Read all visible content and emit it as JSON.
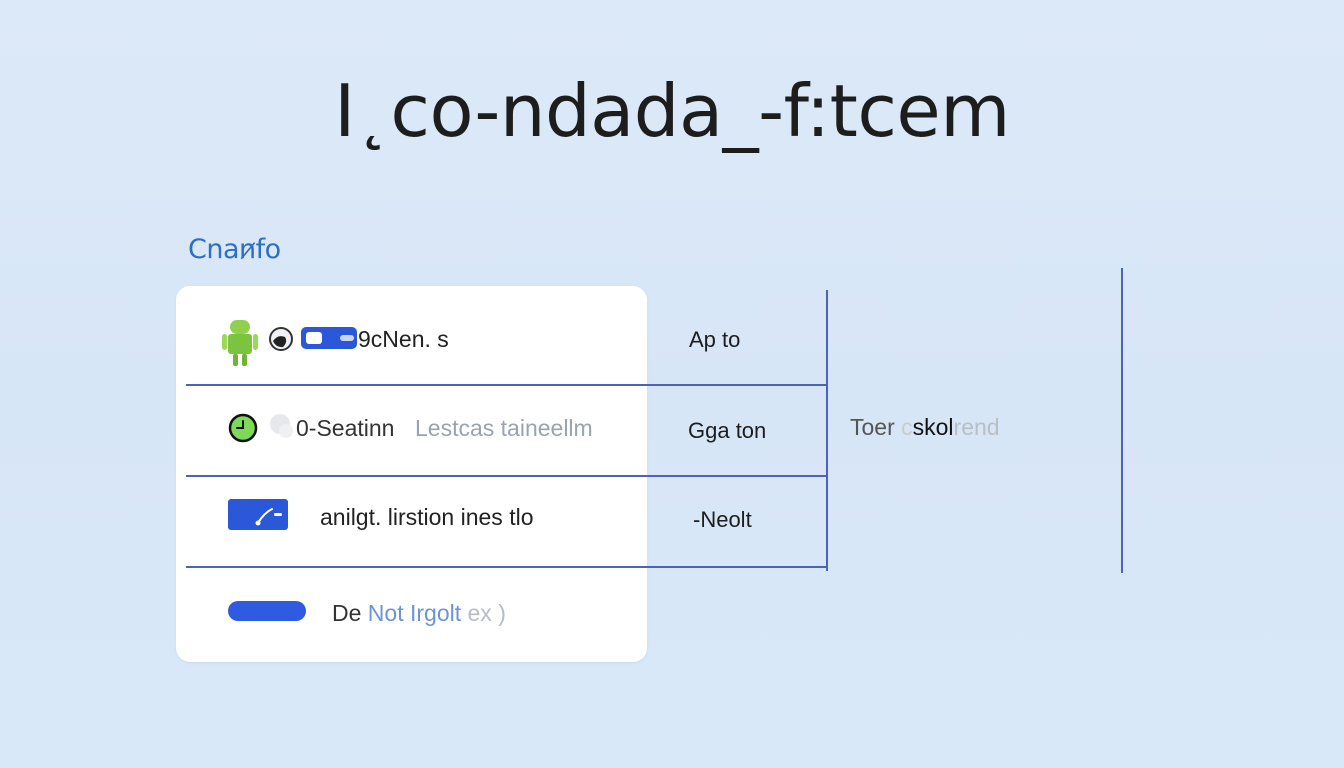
{
  "header": {
    "title": "I˛co-ndada_-f:tcem"
  },
  "section": {
    "label": "Cnan̷fo"
  },
  "rows": [
    {
      "label": "9cNen. s",
      "status": "Ap to",
      "icons": [
        "android-robot-icon",
        "globe-icon",
        "toggle-switch-icon"
      ]
    },
    {
      "label": "0-Seatinn",
      "label_faded": "Lestcas taineellm",
      "status": "Gga ton",
      "icons": [
        "clock-icon",
        "cloud-icon"
      ]
    },
    {
      "label": "anilgt. lirstion ines tlo",
      "status": "-Neolt",
      "icons": [
        "folder-link-icon"
      ]
    },
    {
      "label_dark": "De",
      "label_accent": "Not Irgolt",
      "label_faded": "ex )",
      "icons": [
        "progress-bar-icon"
      ]
    }
  ],
  "side": {
    "text_a": "Toer",
    "text_b": " c",
    "text_c": "skol",
    "text_d": "rend"
  },
  "colors": {
    "background": "#dbe8f8",
    "rule": "#4b64b8",
    "accent": "#2f6fc1",
    "icon_blue": "#2a58d8",
    "icon_green": "#7ed957"
  }
}
